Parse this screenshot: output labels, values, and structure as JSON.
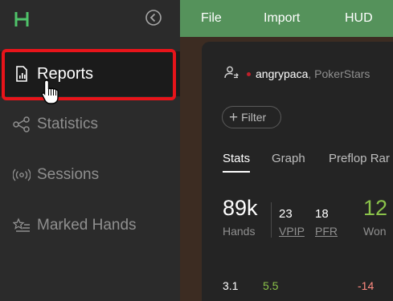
{
  "sidebar": {
    "logo_icon": "hm-logo-icon",
    "collapse_icon": "circle-chevron-left-icon",
    "items": [
      {
        "label": "Reports",
        "icon": "report-file-icon",
        "active": true
      },
      {
        "label": "Statistics",
        "icon": "share-nodes-icon",
        "active": false
      },
      {
        "label": "Sessions",
        "icon": "broadcast-icon",
        "active": false
      },
      {
        "label": "Marked Hands",
        "icon": "star-list-icon",
        "active": false
      }
    ]
  },
  "menu": {
    "file": "File",
    "import": "Import",
    "hud": "HUD"
  },
  "player": {
    "name": "angrypaca",
    "site": ", PokerStars",
    "icon": "user-switch-icon"
  },
  "filter": {
    "label": "Filter"
  },
  "tabs": [
    "Stats",
    "Graph",
    "Preflop Rar"
  ],
  "stats": {
    "hands_value": "89k",
    "hands_label": "Hands",
    "vpip_value": "23",
    "vpip_label": "VPIP",
    "pfr_value": "18",
    "pfr_label": "PFR",
    "won_value": "12",
    "won_label": "Won"
  },
  "bottom_numbers": [
    "3.1",
    "5.5",
    "-14"
  ],
  "colors": {
    "accent_green": "#55925b",
    "highlight_red": "#e8141a",
    "positive": "#8bc34a",
    "negative": "#ff8a80"
  }
}
